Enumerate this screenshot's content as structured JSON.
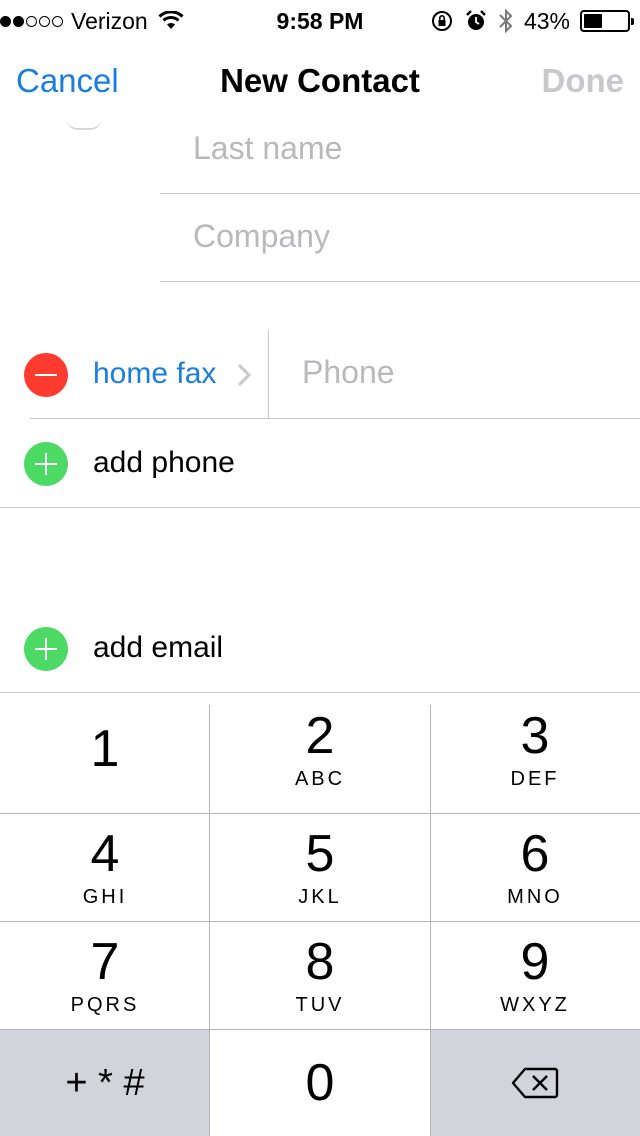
{
  "status_bar": {
    "carrier": "Verizon",
    "time": "9:58 PM",
    "battery_percent": "43%",
    "battery_level": 0.43,
    "signal_bars_filled": 2,
    "signal_bars_total": 5,
    "icons": [
      "wifi-icon",
      "orientation-lock-icon",
      "alarm-icon",
      "bluetooth-icon",
      "battery-icon"
    ]
  },
  "nav": {
    "cancel": "Cancel",
    "title": "New Contact",
    "done": "Done"
  },
  "form": {
    "last_name_placeholder": "Last name",
    "company_placeholder": "Company",
    "phone_label": "home fax",
    "phone_placeholder": "Phone",
    "add_phone": "add phone",
    "add_email": "add email"
  },
  "keypad": {
    "keys": [
      {
        "digit": "1",
        "letters": ""
      },
      {
        "digit": "2",
        "letters": "ABC"
      },
      {
        "digit": "3",
        "letters": "DEF"
      },
      {
        "digit": "4",
        "letters": "GHI"
      },
      {
        "digit": "5",
        "letters": "JKL"
      },
      {
        "digit": "6",
        "letters": "MNO"
      },
      {
        "digit": "7",
        "letters": "PQRS"
      },
      {
        "digit": "8",
        "letters": "TUV"
      },
      {
        "digit": "9",
        "letters": "WXYZ"
      },
      {
        "digit": "+ * #",
        "letters": ""
      },
      {
        "digit": "0",
        "letters": ""
      },
      {
        "digit": "",
        "letters": ""
      }
    ]
  },
  "colors": {
    "accent": "#1a7de0",
    "remove": "#ff3b30",
    "add": "#4cd964",
    "placeholder": "#b8b8bd",
    "keypad_gray": "#d1d5db"
  }
}
